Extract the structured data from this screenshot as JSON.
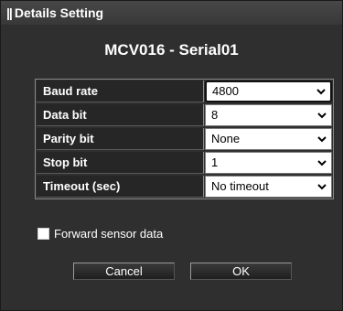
{
  "window": {
    "title": "Details Setting",
    "grip_icon": "||"
  },
  "heading": "MCV016 - Serial01",
  "settings": [
    {
      "label": "Baud rate",
      "value": "4800"
    },
    {
      "label": "Data bit",
      "value": "8"
    },
    {
      "label": "Parity bit",
      "value": "None"
    },
    {
      "label": "Stop bit",
      "value": "1"
    },
    {
      "label": "Timeout (sec)",
      "value": "No timeout"
    }
  ],
  "forward_sensor": {
    "label": "Forward sensor data",
    "checked": false
  },
  "buttons": {
    "cancel": "Cancel",
    "ok": "OK"
  },
  "colors": {
    "dialog_bg": "#2f2f2f",
    "label_bg": "#262626",
    "text": "#ffffff"
  }
}
